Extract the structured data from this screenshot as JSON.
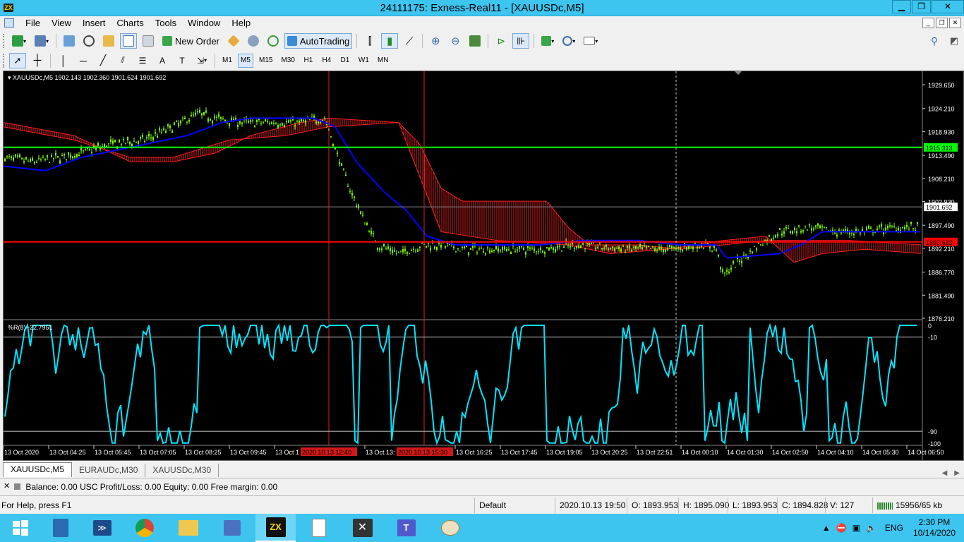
{
  "window": {
    "title": "24111175: Exness-Real11 - [XAUUSDc,M5]",
    "minimize": "▁",
    "restore": "❐",
    "close": "✕"
  },
  "menu": [
    "File",
    "View",
    "Insert",
    "Charts",
    "Tools",
    "Window",
    "Help"
  ],
  "mdi_buttons": [
    "_",
    "❐",
    "✕"
  ],
  "toolbar": {
    "new_order": "New Order",
    "autotrading": "AutoTrading"
  },
  "timeframes": [
    "M1",
    "M5",
    "M15",
    "M30",
    "H1",
    "H4",
    "D1",
    "W1",
    "MN"
  ],
  "active_timeframe": "M5",
  "chart": {
    "header": "XAUUSDc,M5  1902.143 1902.360 1901.624 1901.692",
    "indicator_header": "%R(8) -22.7951",
    "price_ticks": [
      "1929.650",
      "1924.210",
      "1918.930",
      "1913.490",
      "1908.210",
      "1902.930",
      "1897.490",
      "1892.210",
      "1886.770",
      "1881.490",
      "1876.210"
    ],
    "current_price": "1901.692",
    "green_line_price": "1915.313",
    "red_line_price": "1893.683",
    "wr_ticks": [
      "0",
      "-10",
      "-90",
      "-100"
    ],
    "time_labels": [
      "13 Oct 2020",
      "13 Oct 04:25",
      "13 Oct 05:45",
      "13 Oct 07:05",
      "13 Oct 08:25",
      "13 Oct 09:45",
      "13 Oct 1",
      "13 Oct 13:",
      "13 Oct 16:25",
      "13 Oct 17:45",
      "13 Oct 19:05",
      "13 Oct 20:25",
      "13 Oct 22:51",
      "14 Oct 00:10",
      "14 Oct 01:30",
      "14 Oct 02:50",
      "14 Oct 04:10",
      "14 Oct 05:30",
      "14 Oct 06:50"
    ],
    "marker_labels": [
      "2020.10.13 12:40",
      "2020.10.13 15:30"
    ],
    "colors": {
      "candle": "#7fff00",
      "kijun": "#0000ff",
      "cloud": "#ff2020",
      "green_line": "#00ff00",
      "red_line": "#ff0000",
      "wr": "#00e5ff"
    }
  },
  "tabs": [
    "XAUUSDc,M5",
    "EURAUDc,M30",
    "XAUUSDc,M30"
  ],
  "terminal": {
    "balance": "Balance: 0.00 USC  Profit/Loss: 0.00  Equity: 0.00  Free margin: 0.00"
  },
  "status": {
    "help": "For Help, press F1",
    "profile": "Default",
    "datetime": "2020.10.13 19:50",
    "open": "O: 1893.953",
    "high": "H: 1895.090",
    "low": "L: 1893.953",
    "close": "C: 1894.828",
    "volume": "V: 127",
    "traffic": "15956/65 kb"
  },
  "taskbar": {
    "lang": "ENG",
    "time": "2:30 PM",
    "date": "10/14/2020"
  }
}
